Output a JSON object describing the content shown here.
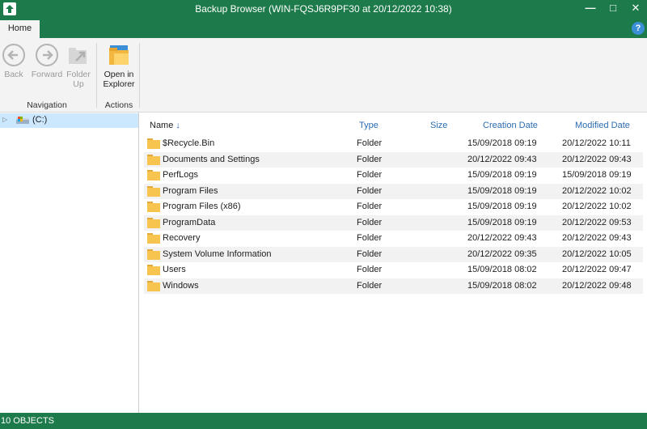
{
  "window": {
    "title": "Backup Browser (WIN-FQSJ6R9PF30 at 20/12/2022 10:38)",
    "minimize_glyph": "—",
    "maximize_glyph": "□",
    "close_glyph": "✕",
    "accent_color": "#1d7a4b"
  },
  "ribbon": {
    "tab_home": "Home",
    "help_glyph": "?",
    "navigation": {
      "group_label": "Navigation",
      "back_label": "Back",
      "forward_label": "Forward",
      "folder_up_line1": "Folder",
      "folder_up_line2": "Up"
    },
    "actions": {
      "group_label": "Actions",
      "open_line1": "Open in",
      "open_line2": "Explorer"
    }
  },
  "tree": {
    "drive_label": "(C:)",
    "expand_glyph": "▷"
  },
  "list": {
    "columns": {
      "name": "Name",
      "sort_glyph": "↓",
      "type": "Type",
      "size": "Size",
      "created": "Creation Date",
      "modified": "Modified Date"
    },
    "rows": [
      {
        "name": "$Recycle.Bin",
        "type": "Folder",
        "size": "",
        "created": "15/09/2018 09:19",
        "modified": "20/12/2022 10:11"
      },
      {
        "name": "Documents and Settings",
        "type": "Folder",
        "size": "",
        "created": "20/12/2022 09:43",
        "modified": "20/12/2022 09:43"
      },
      {
        "name": "PerfLogs",
        "type": "Folder",
        "size": "",
        "created": "15/09/2018 09:19",
        "modified": "15/09/2018 09:19"
      },
      {
        "name": "Program Files",
        "type": "Folder",
        "size": "",
        "created": "15/09/2018 09:19",
        "modified": "20/12/2022 10:02"
      },
      {
        "name": "Program Files (x86)",
        "type": "Folder",
        "size": "",
        "created": "15/09/2018 09:19",
        "modified": "20/12/2022 10:02"
      },
      {
        "name": "ProgramData",
        "type": "Folder",
        "size": "",
        "created": "15/09/2018 09:19",
        "modified": "20/12/2022 09:53"
      },
      {
        "name": "Recovery",
        "type": "Folder",
        "size": "",
        "created": "20/12/2022 09:43",
        "modified": "20/12/2022 09:43"
      },
      {
        "name": "System Volume Information",
        "type": "Folder",
        "size": "",
        "created": "20/12/2022 09:35",
        "modified": "20/12/2022 10:05"
      },
      {
        "name": "Users",
        "type": "Folder",
        "size": "",
        "created": "15/09/2018 08:02",
        "modified": "20/12/2022 09:47"
      },
      {
        "name": "Windows",
        "type": "Folder",
        "size": "",
        "created": "15/09/2018 08:02",
        "modified": "20/12/2022 09:48"
      }
    ]
  },
  "status": {
    "text": "10 OBJECTS"
  }
}
